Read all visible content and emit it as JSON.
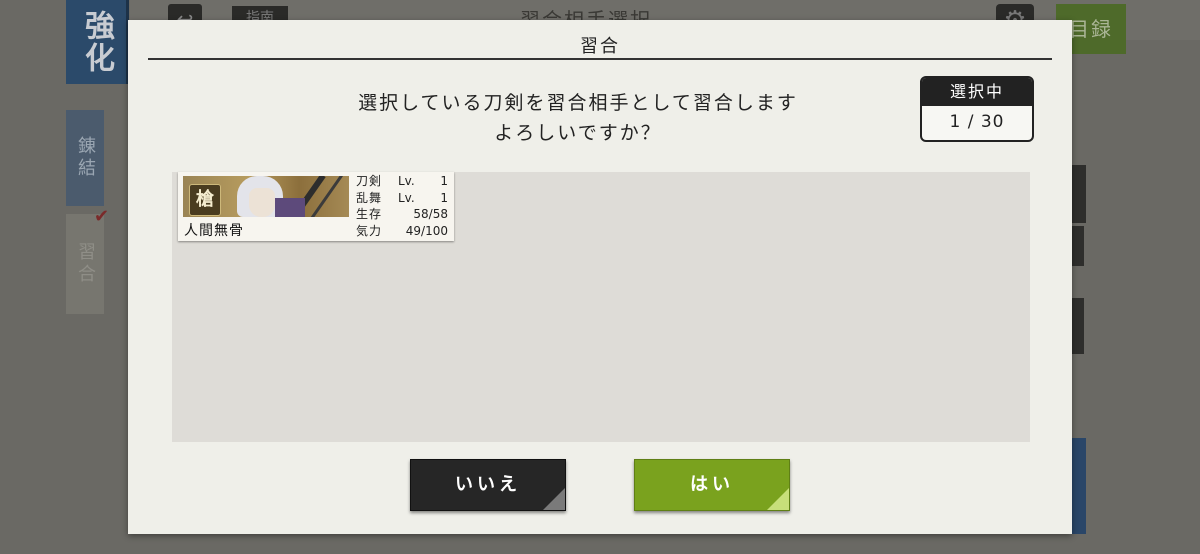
{
  "background": {
    "screen_title": "習合相手選択",
    "enhance_label": "強化",
    "back_label": "↩",
    "flag_label": "指南",
    "catalog_label": "目録",
    "side_tabs": [
      {
        "label": "錬結"
      },
      {
        "label": "習合"
      }
    ]
  },
  "dialog": {
    "title": "習合",
    "message_line1": "選択している刀剣を習合相手として習合します",
    "message_line2": "よろしいですか？",
    "counter": {
      "header": "選択中",
      "selected": "1",
      "separator": "/",
      "total": "30"
    },
    "selected_cards": [
      {
        "name": "人間無骨",
        "weapon_type": "槍",
        "stats": [
          {
            "key": "刀剣",
            "mid": "Lv.",
            "value": "1"
          },
          {
            "key": "乱舞",
            "mid": "Lv.",
            "value": "1"
          },
          {
            "key": "生存",
            "mid": "",
            "value": "58/58"
          },
          {
            "key": "気力",
            "mid": "",
            "value": "49/100"
          }
        ]
      }
    ],
    "buttons": {
      "no_label": "いいえ",
      "yes_label": "はい"
    }
  },
  "colors": {
    "yes_button": "#7aa21e",
    "no_button": "#262626",
    "modal_background": "#efefe9",
    "list_background": "#dedcd7"
  }
}
